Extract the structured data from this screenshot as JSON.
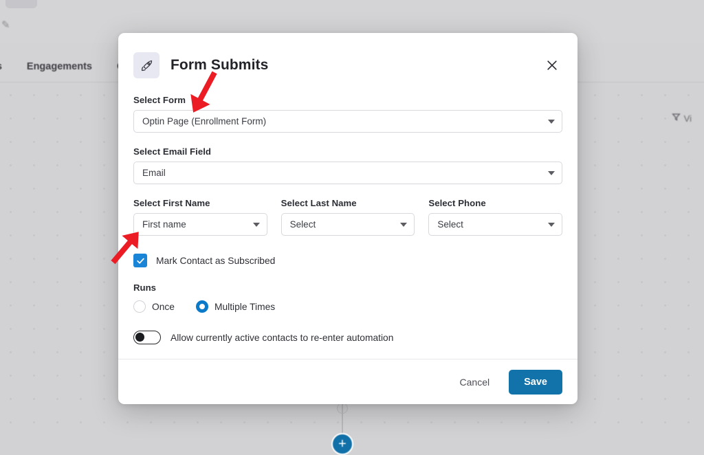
{
  "background": {
    "edit_icon": "pencil-icon",
    "tabs": [
      {
        "label": "ts"
      },
      {
        "label": "Engagements"
      },
      {
        "label": "O"
      }
    ],
    "filter": {
      "icon": "funnel-icon",
      "label": "Vi"
    },
    "canvas_node_plus": "+"
  },
  "modal": {
    "icon": "rocket-icon",
    "title": "Form Submits",
    "close_icon": "close-icon",
    "fields": {
      "select_form": {
        "label": "Select Form",
        "value": "Optin Page (Enrollment Form)",
        "caret_icon": "chevron-down-icon"
      },
      "select_email_field": {
        "label": "Select Email Field",
        "value": "Email",
        "caret_icon": "chevron-down-icon"
      },
      "select_first_name": {
        "label": "Select First Name",
        "value": "First name",
        "caret_icon": "chevron-down-icon"
      },
      "select_last_name": {
        "label": "Select Last Name",
        "value": "Select",
        "caret_icon": "chevron-down-icon"
      },
      "select_phone": {
        "label": "Select Phone",
        "value": "Select",
        "caret_icon": "chevron-down-icon"
      }
    },
    "subscribed_checkbox": {
      "label": "Mark Contact as Subscribed",
      "checked": true,
      "icon": "check-icon"
    },
    "runs": {
      "label": "Runs",
      "options": [
        {
          "label": "Once",
          "selected": false
        },
        {
          "label": "Multiple Times",
          "selected": true
        }
      ]
    },
    "reenter_toggle": {
      "label": "Allow currently active contacts to re-enter automation",
      "enabled": false
    },
    "footer": {
      "cancel_label": "Cancel",
      "save_label": "Save"
    }
  },
  "annotations": [
    {
      "name": "arrow-to-select-form",
      "color": "#ec1c24"
    },
    {
      "name": "arrow-to-select-first-name",
      "color": "#ec1c24"
    }
  ],
  "colors": {
    "accent_blue": "#1272aa",
    "checkbox_blue": "#1a84d6",
    "radio_blue": "#0a7ac9",
    "annotation_red": "#ec1c24",
    "page_bg": "#d2d2d4",
    "modal_bg": "#ffffff"
  }
}
